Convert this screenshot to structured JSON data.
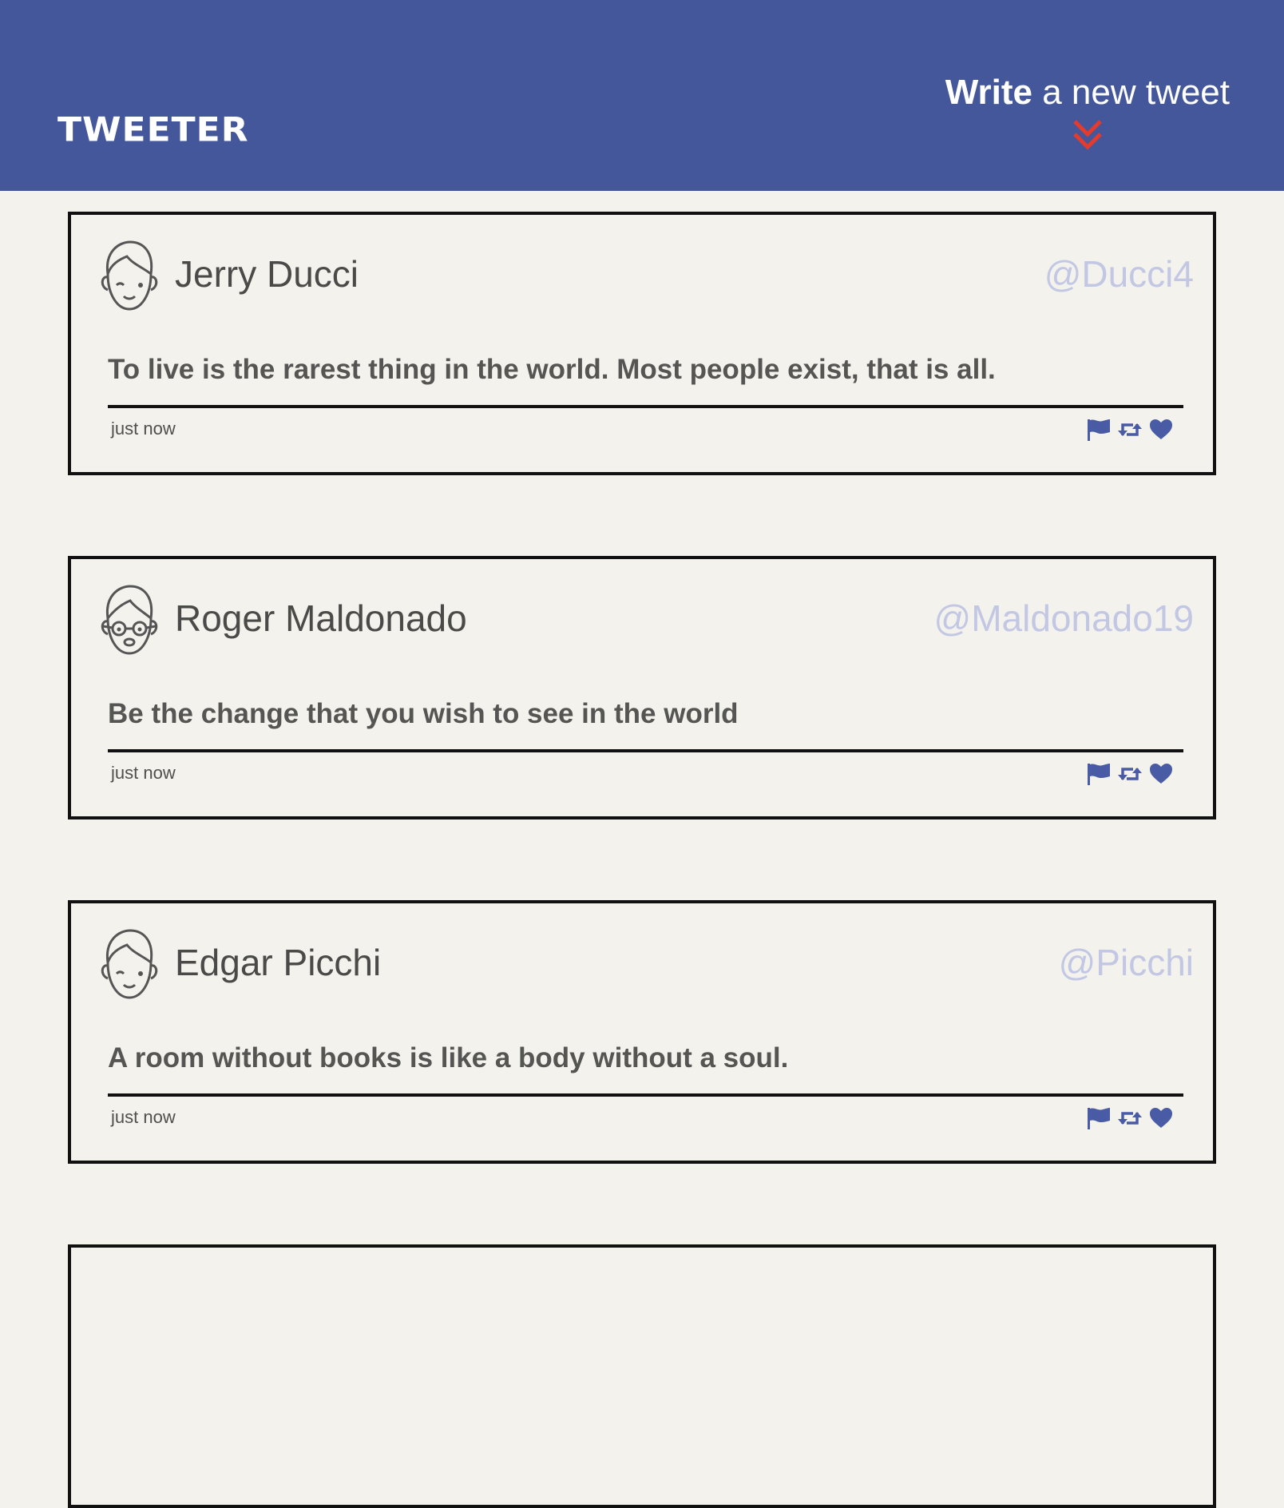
{
  "header": {
    "brand": "TWEETER",
    "compose_strong": "Write",
    "compose_rest": "a new tweet",
    "compose_arrow_icon": "double-chevron-down-icon",
    "compose_arrow_color": "#e53b2c"
  },
  "colors": {
    "navbar": "#44579b",
    "background": "#f4f2ed",
    "handle": "#c2c7e3",
    "action_icons": "#4a5ba6"
  },
  "tweets": [
    {
      "avatar_icon": "boy-face-avatar-icon",
      "name": "Jerry Ducci",
      "handle": "@Ducci4",
      "content": "To live is the rarest thing in the world. Most people exist, that is all.",
      "time": "just now"
    },
    {
      "avatar_icon": "glasses-face-avatar-icon",
      "name": "Roger Maldonado",
      "handle": "@Maldonado19",
      "content": "Be the change that you wish to see in the world",
      "time": "just now"
    },
    {
      "avatar_icon": "boy-face-avatar-icon",
      "name": "Edgar Picchi",
      "handle": "@Picchi",
      "content": "A room without books is like a body without a soul.",
      "time": "just now"
    }
  ],
  "action_icons": [
    "flag-icon",
    "retweet-icon",
    "heart-icon"
  ]
}
